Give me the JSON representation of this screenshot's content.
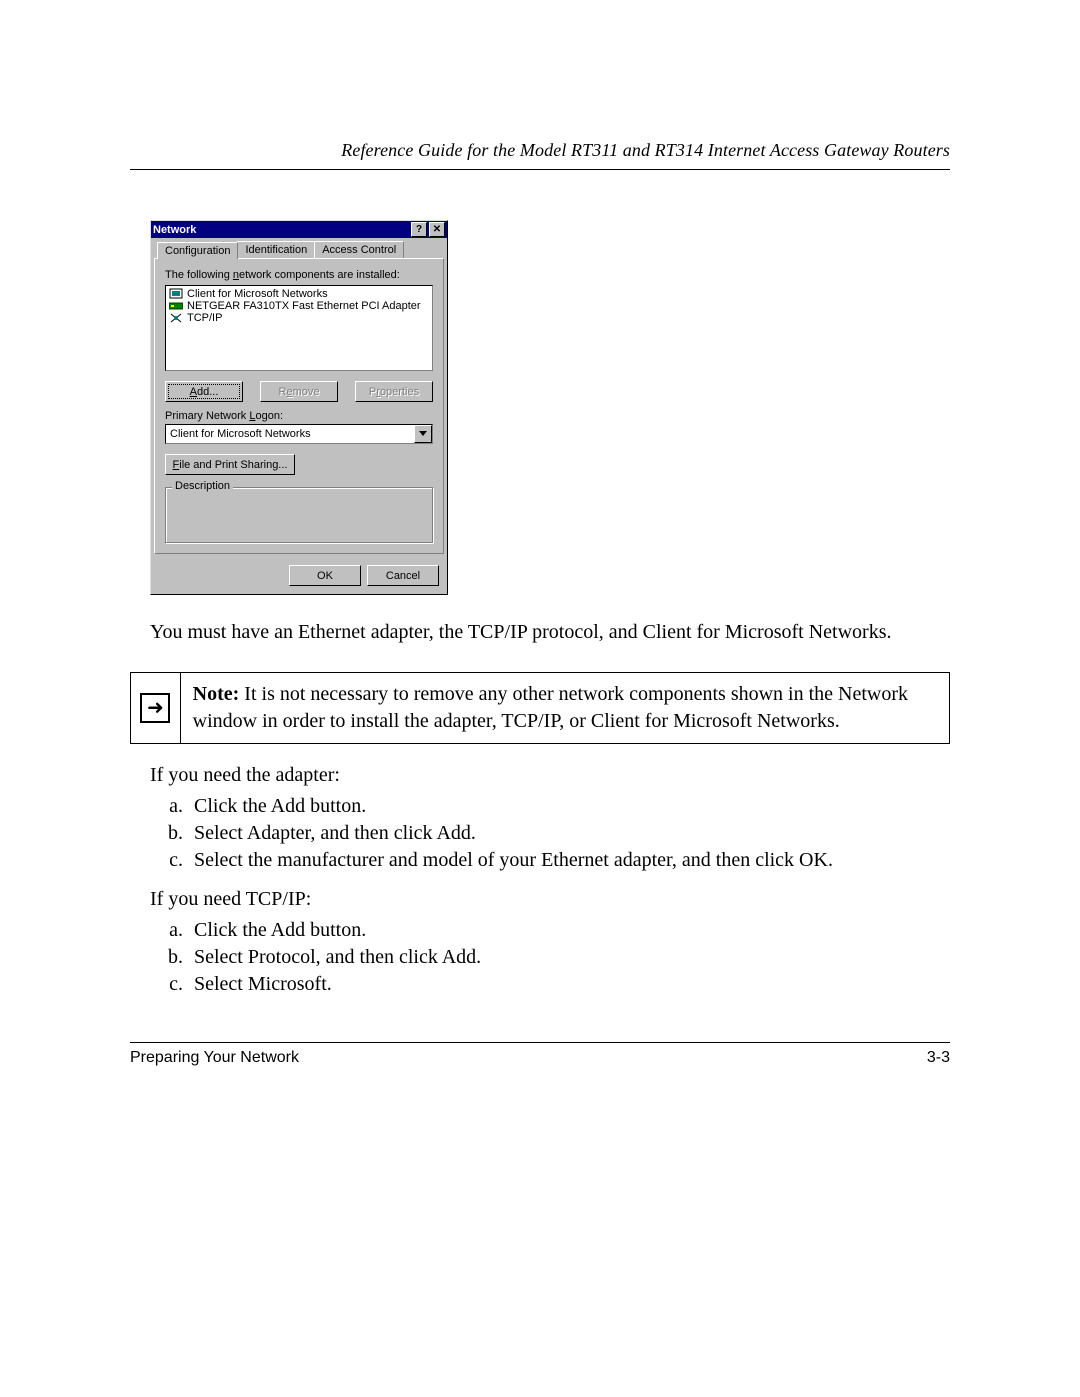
{
  "header": {
    "running": "Reference Guide for the Model RT311 and RT314 Internet Access Gateway Routers"
  },
  "dialog": {
    "title": "Network",
    "help_glyph": "?",
    "close_glyph": "✕",
    "tabs": {
      "config": "Configuration",
      "ident": "Identification",
      "access": "Access Control"
    },
    "list_intro": "The following network components are installed:",
    "components": {
      "client": "Client for Microsoft Networks",
      "adapter": "NETGEAR FA310TX Fast Ethernet PCI Adapter",
      "tcpip": "TCP/IP"
    },
    "buttons": {
      "add": "Add...",
      "remove": "Remove",
      "properties": "Properties"
    },
    "logon_label": "Primary Network Logon:",
    "logon_value": "Client for Microsoft Networks",
    "file_print": "File and Print Sharing...",
    "description_legend": "Description",
    "ok": "OK",
    "cancel": "Cancel"
  },
  "body": {
    "p1": "You must have an Ethernet adapter, the TCP/IP protocol, and Client for Microsoft Networks.",
    "note_label": "Note:",
    "note_text": " It is not necessary to remove any other network components shown in the Network window in order to install the adapter, TCP/IP, or Client for Microsoft Networks.",
    "adapter_head": "If you need the adapter:",
    "adapter_steps": {
      "a": "Click the Add button.",
      "b": "Select Adapter, and then click Add.",
      "c": "Select the manufacturer and model of your Ethernet adapter, and then click OK."
    },
    "tcpip_head": "If you need TCP/IP:",
    "tcpip_steps": {
      "a": "Click the Add button.",
      "b": "Select Protocol, and then click Add.",
      "c": "Select Microsoft."
    }
  },
  "footer": {
    "section": "Preparing Your Network",
    "page": "3-3"
  }
}
